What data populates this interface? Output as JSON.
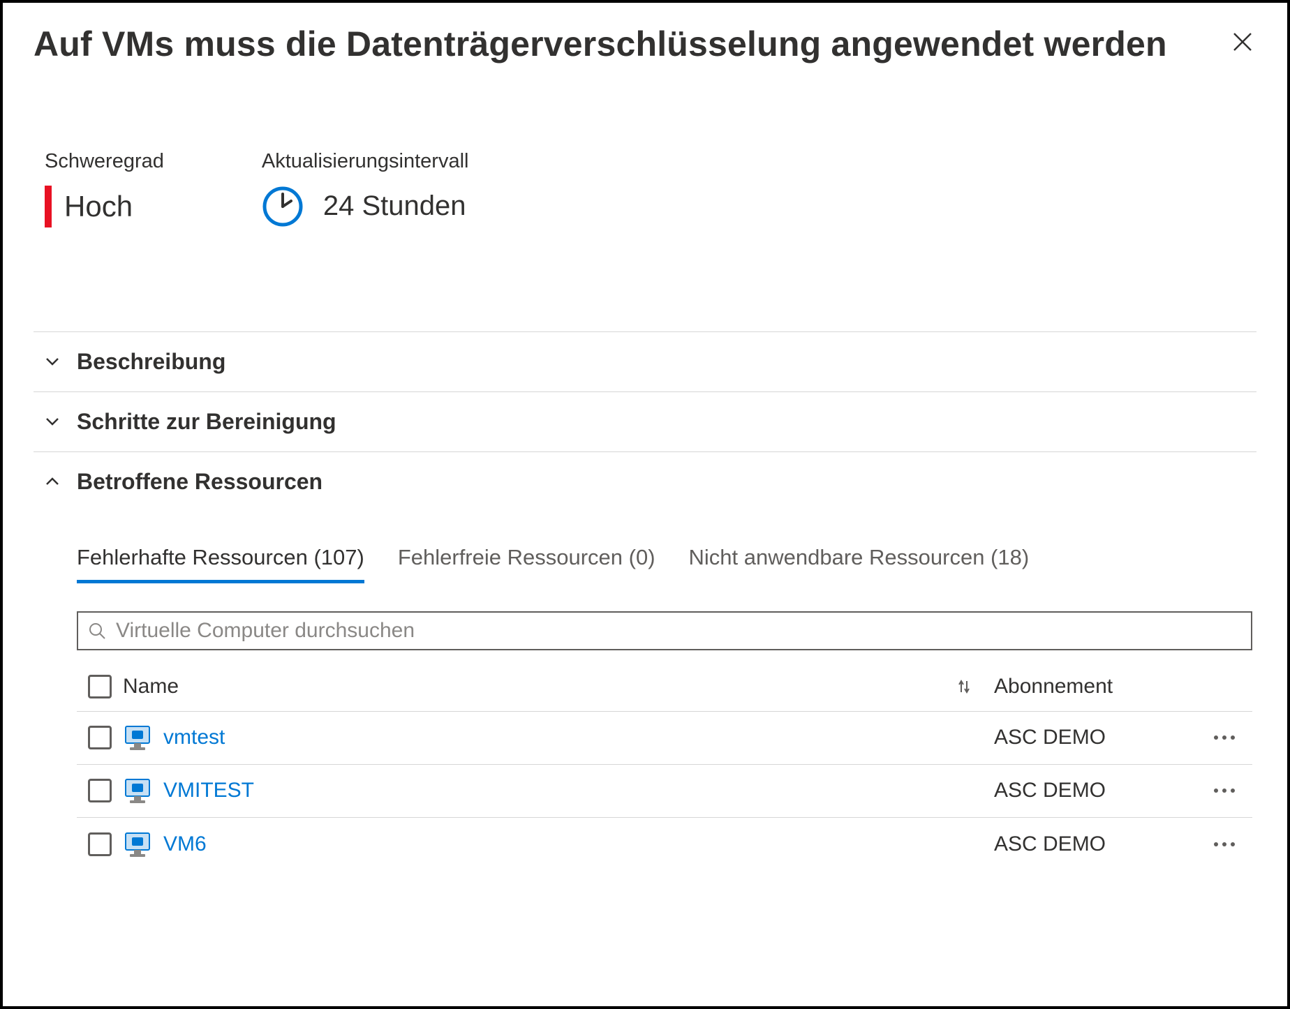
{
  "header": {
    "title": "Auf VMs muss die Datenträgerverschlüsselung angewendet werden"
  },
  "info": {
    "severity_label": "Schweregrad",
    "severity_value": "Hoch",
    "interval_label": "Aktualisierungsintervall",
    "interval_value": "24 Stunden"
  },
  "sections": {
    "description": "Beschreibung",
    "remediation": "Schritte zur Bereinigung",
    "affected": "Betroffene Ressourcen"
  },
  "tabs": {
    "unhealthy": "Fehlerhafte Ressourcen (107)",
    "healthy": "Fehlerfreie Ressourcen (0)",
    "not_applicable": "Nicht anwendbare Ressourcen (18)"
  },
  "search": {
    "placeholder": "Virtuelle Computer durchsuchen"
  },
  "table": {
    "headers": {
      "name": "Name",
      "subscription": "Abonnement"
    },
    "rows": [
      {
        "name": "vmtest",
        "subscription": "ASC DEMO"
      },
      {
        "name": "VMITEST",
        "subscription": "ASC DEMO"
      },
      {
        "name": "VM6",
        "subscription": "ASC DEMO"
      }
    ]
  }
}
